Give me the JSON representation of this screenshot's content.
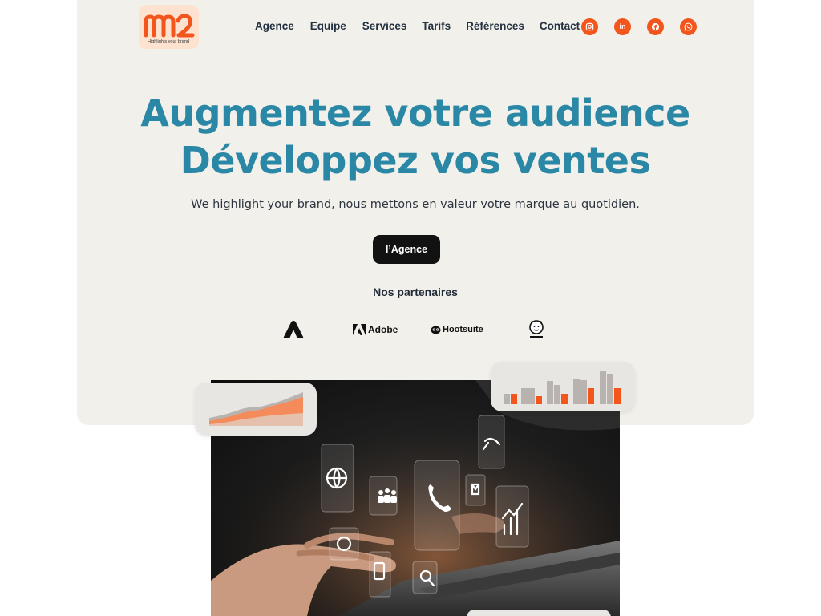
{
  "brand": {
    "logo_text": "m2",
    "tagline": "Highlights your brand",
    "accent_color": "#f2561d",
    "title_color": "#2a88a6"
  },
  "nav": {
    "items": [
      {
        "label": "Agence"
      },
      {
        "label": "Equipe"
      },
      {
        "label": "Services"
      },
      {
        "label": "Tarifs"
      },
      {
        "label": "Références"
      },
      {
        "label": "Contact"
      }
    ]
  },
  "socials": [
    {
      "icon": "instagram-icon"
    },
    {
      "icon": "linkedin-icon",
      "glyph": "in"
    },
    {
      "icon": "facebook-icon"
    },
    {
      "icon": "whatsapp-icon"
    }
  ],
  "hero": {
    "title_line1": "Augmentez votre audience",
    "title_line2": "Développez vos ventes",
    "subtitle": "We highlight your brand, nous mettons en valeur votre marque au quotidien.",
    "cta_label": "l’Agence"
  },
  "partners": {
    "title": "Nos partenaires",
    "items": [
      {
        "name": "adobe-express-logo"
      },
      {
        "name": "Adobe"
      },
      {
        "name": "Hootsuite"
      },
      {
        "name": "mailchimp-logo"
      }
    ]
  }
}
